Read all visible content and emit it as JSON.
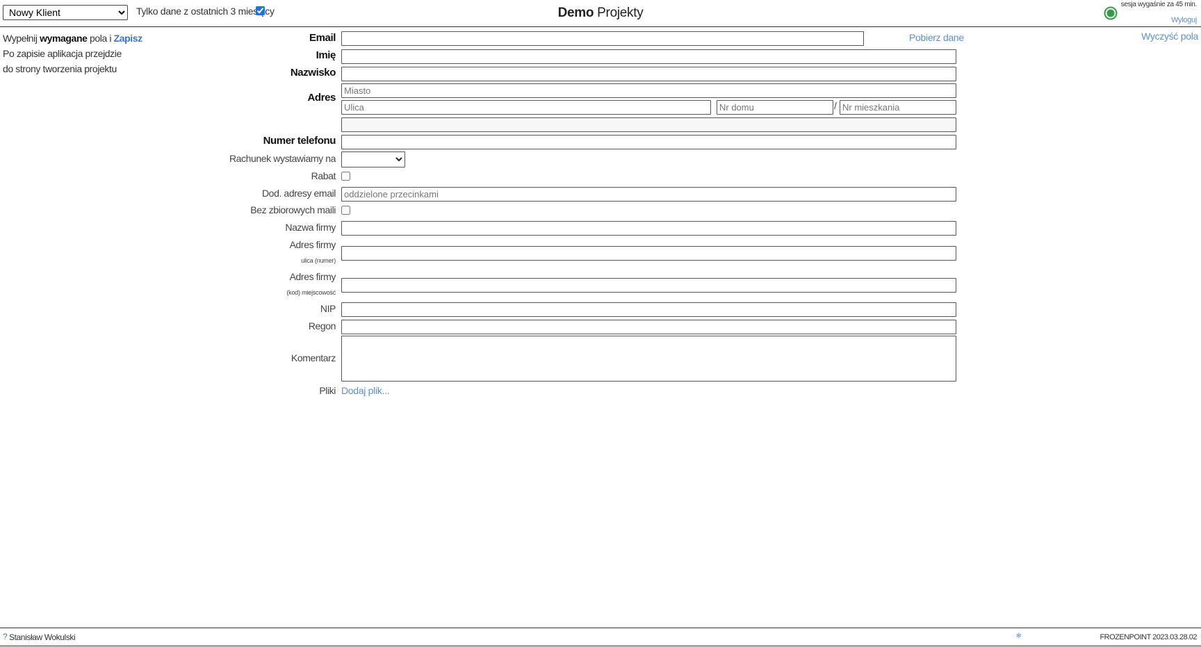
{
  "header": {
    "client_select": {
      "selected": "Nowy Klient",
      "options": [
        "Nowy Klient"
      ]
    },
    "recent_filter": {
      "label": "Tylko dane z ostatnich 3 miesięcy",
      "checked": true
    },
    "title_bold": "Demo",
    "title_rest": "Projekty",
    "status_color": "#2ea043",
    "session_text": "sesja wygaśnie za 45 min.",
    "logout_label": "Wyloguj"
  },
  "info": {
    "line1_prefix": "Wypełnij",
    "line1_bold": "wymagane",
    "line1_middle": "pola i",
    "save_label": "Zapisz",
    "line2": "Po zapisie aplikacja przejdzie",
    "line3": "do strony tworzenia projektu"
  },
  "actions": {
    "clear_label": "Wyczyść pola",
    "fetch_label": "Pobierz dane"
  },
  "form": {
    "email_label": "Email",
    "first_name_label": "Imię",
    "last_name_label": "Nazwisko",
    "address_label": "Adres",
    "city_placeholder": "Miasto",
    "street_placeholder": "Ulica",
    "house_placeholder": "Nr domu",
    "slash": "/",
    "flat_placeholder": "Nr mieszkania",
    "phone_label": "Numer telefonu",
    "invoice_label": "Rachunek wystawiamy na",
    "discount_label": "Rabat",
    "extra_emails_label": "Dod. adresy email",
    "extra_emails_placeholder": "oddzielone przecinkami",
    "no_bulk_label": "Bez zbiorowych maili",
    "company_name_label": "Nazwa firmy",
    "company_address_label": "Adres firmy",
    "company_address_sub": "ulica (numer)",
    "company_address2_label": "Adres firmy",
    "company_address2_sub": "(kod) miejscowość",
    "nip_label": "NIP",
    "regon_label": "Regon",
    "comment_label": "Komentarz",
    "files_label": "Pliki",
    "add_file_label": "Dodaj plik..."
  },
  "footer": {
    "help_icon": "?",
    "user_name": "Stanisław Wokulski",
    "brand_icon": "snowflake-icon",
    "version": "FROZENPOINT 2023.03.28.02"
  }
}
